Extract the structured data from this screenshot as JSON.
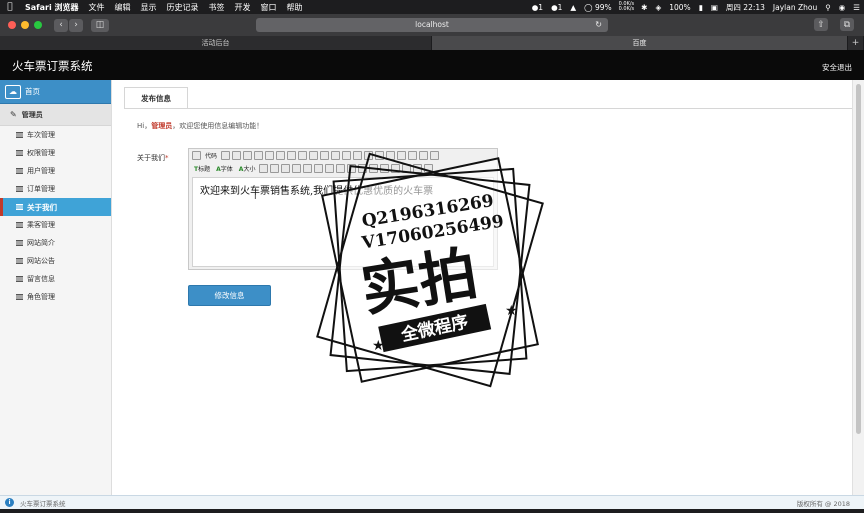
{
  "menubar": {
    "app": "Safari 浏览器",
    "items": [
      "文件",
      "编辑",
      "显示",
      "历史记录",
      "书签",
      "开发",
      "窗口",
      "帮助"
    ],
    "status": {
      "badge1": "1",
      "badge2": "1",
      "battery": "99%",
      "net_up": "0.0K/s",
      "net_down": "0.0K/s",
      "battery_pct": "100%",
      "clock": "周四 22:13",
      "user": "Jaylan Zhou"
    }
  },
  "browser": {
    "address": "localhost",
    "tabs": [
      {
        "label": "活动后台"
      },
      {
        "label": "百度"
      }
    ]
  },
  "app": {
    "title": "火车票订票系统",
    "logout": "安全退出"
  },
  "sidebar": {
    "home": "首页",
    "group": "管理员",
    "items": [
      {
        "label": "车次管理"
      },
      {
        "label": "权限管理"
      },
      {
        "label": "用户管理"
      },
      {
        "label": "订单管理"
      },
      {
        "label": "关于我们"
      },
      {
        "label": "乘客管理"
      },
      {
        "label": "网站简介"
      },
      {
        "label": "网站公告"
      },
      {
        "label": "留言信息"
      },
      {
        "label": "角色管理"
      }
    ]
  },
  "main": {
    "tab": "发布信息",
    "greet_prefix": "Hi，",
    "greet_role": "管理员",
    "greet_suffix": "，欢迎您使用信息编辑功能！",
    "field_label": "关于我们",
    "field_required": "*",
    "editor": {
      "toolbar1_code": "代码",
      "toolbar2_title": "标题",
      "toolbar2_font": "字体",
      "toolbar2_size": "大小",
      "content": "欢迎来到火车票销售系统,我们提供优惠优质的火车票"
    },
    "submit": "修改信息"
  },
  "footer": {
    "left": "火车票订票系统",
    "right": "版权所有 @ 2018"
  },
  "watermark": {
    "qq": "Q2196316269",
    "wechat": "V17060256499",
    "big": "实拍",
    "banner": "全微程序"
  }
}
